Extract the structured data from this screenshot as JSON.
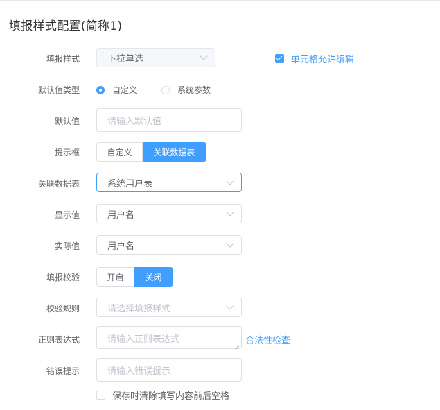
{
  "title": "填报样式配置(简称1)",
  "fields": {
    "style": {
      "label": "填报样式",
      "value": "下拉单选"
    },
    "cell_edit": {
      "label": "单元格允许编辑",
      "checked": true
    },
    "default_type": {
      "label": "默认值类型",
      "options": [
        "自定义",
        "系统参数"
      ],
      "selected": "自定义"
    },
    "default_value": {
      "label": "默认值",
      "placeholder": "请输入默认值"
    },
    "prompt": {
      "label": "提示框",
      "options": [
        "自定义",
        "关联数据表"
      ],
      "selected": "关联数据表"
    },
    "related_table": {
      "label": "关联数据表",
      "value": "系统用户表"
    },
    "display_value": {
      "label": "显示值",
      "value": "用户名"
    },
    "actual_value": {
      "label": "实际值",
      "value": "用户名"
    },
    "validation": {
      "label": "填报校验",
      "options": [
        "开启",
        "关闭"
      ],
      "selected": "关闭"
    },
    "rule": {
      "label": "校验规则",
      "placeholder": "请选择填报样式"
    },
    "regex": {
      "label": "正则表达式",
      "placeholder": "请输入正则表达式",
      "link": "合法性检查"
    },
    "error_tip": {
      "label": "错误提示",
      "placeholder": "请输入错误提示"
    },
    "trim": {
      "label": "保存时清除填写内容前后空格",
      "checked": false
    }
  },
  "colors": {
    "accent": "#409eff",
    "border": "#dcdfe6",
    "placeholder": "#c0c4cc"
  }
}
